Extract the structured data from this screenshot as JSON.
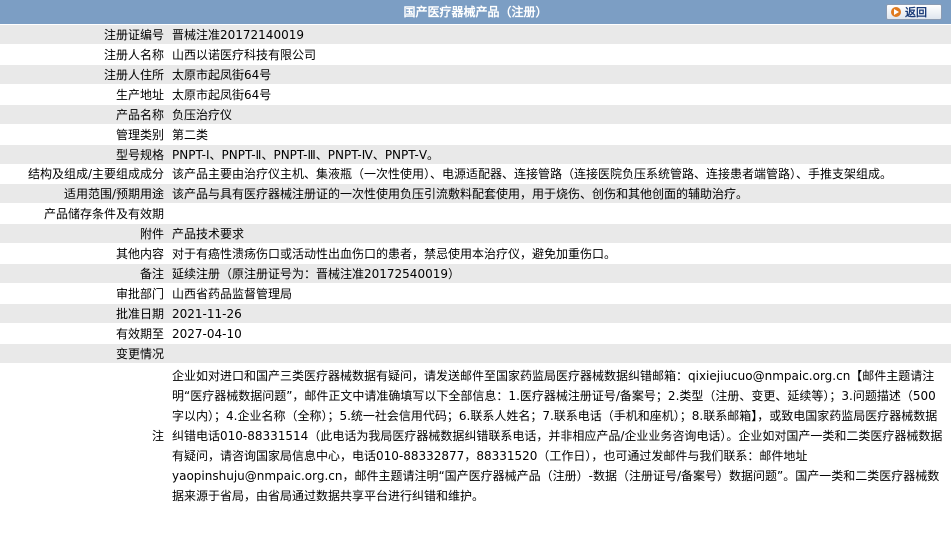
{
  "header": {
    "title": "国产医疗器械产品（注册）",
    "back_label": "返回"
  },
  "fields": [
    {
      "label": "注册证编号",
      "value": "晋械注准20172140019"
    },
    {
      "label": "注册人名称",
      "value": "山西以诺医疗科技有限公司"
    },
    {
      "label": "注册人住所",
      "value": "太原市起凤街64号"
    },
    {
      "label": "生产地址",
      "value": "太原市起凤街64号"
    },
    {
      "label": "产品名称",
      "value": "负压治疗仪"
    },
    {
      "label": "管理类别",
      "value": "第二类"
    },
    {
      "label": "型号规格",
      "value": "PNPT-Ⅰ、PNPT-Ⅱ、PNPT-Ⅲ、PNPT-Ⅳ、PNPT-Ⅴ。"
    },
    {
      "label": "结构及组成/主要组成成分",
      "value": "该产品主要由治疗仪主机、集液瓶（一次性使用）、电源适配器、连接管路（连接医院负压系统管路、连接患者端管路）、手推支架组成。"
    },
    {
      "label": "适用范围/预期用途",
      "value": "该产品与具有医疗器械注册证的一次性使用负压引流敷料配套使用，用于烧伤、创伤和其他创面的辅助治疗。"
    },
    {
      "label": "产品储存条件及有效期",
      "value": ""
    },
    {
      "label": "附件",
      "value": "产品技术要求"
    },
    {
      "label": "其他内容",
      "value": "对于有癌性溃疡伤口或活动性出血伤口的患者，禁忌使用本治疗仪，避免加重伤口。"
    },
    {
      "label": "备注",
      "value": "延续注册（原注册证号为：晋械注准20172540019）"
    },
    {
      "label": "审批部门",
      "value": "山西省药品监督管理局"
    },
    {
      "label": "批准日期",
      "value": "2021-11-26"
    },
    {
      "label": "有效期至",
      "value": "2027-04-10"
    },
    {
      "label": "变更情况",
      "value": ""
    }
  ],
  "note": {
    "label": "注",
    "text": "企业如对进口和国产三类医疗器械数据有疑问，请发送邮件至国家药监局医疗器械数据纠错邮箱：qixiejiucuo@nmpaic.org.cn【邮件主题请注明“医疗器械数据问题”，邮件正文中请准确填写以下全部信息：1.医疗器械注册证号/备案号；2.类型（注册、变更、延续等）；3.问题描述（500字以内）；4.企业名称（全称）；5.统一社会信用代码；6.联系人姓名；7.联系电话（手机和座机）；8.联系邮箱】，或致电国家药监局医疗器械数据纠错电话010-88331514（此电话为我局医疗器械数据纠错联系电话，并非相应产品/企业业务咨询电话）。企业如对国产一类和二类医疗器械数据有疑问，请咨询国家局信息中心，电话010-88332877，88331520（工作日），也可通过发邮件与我们联系：邮件地址yaopinshuju@nmpaic.org.cn，邮件主题请注明“国产医疗器械产品（注册）-数据（注册证号/备案号）数据问题”。国产一类和二类医疗器械数据来源于省局，由省局通过数据共享平台进行纠错和维护。"
  },
  "colors": {
    "header_bg": "#7c9ec4",
    "row_alt_bg": "#e9e9e9",
    "back_icon": "#e07a1f"
  }
}
